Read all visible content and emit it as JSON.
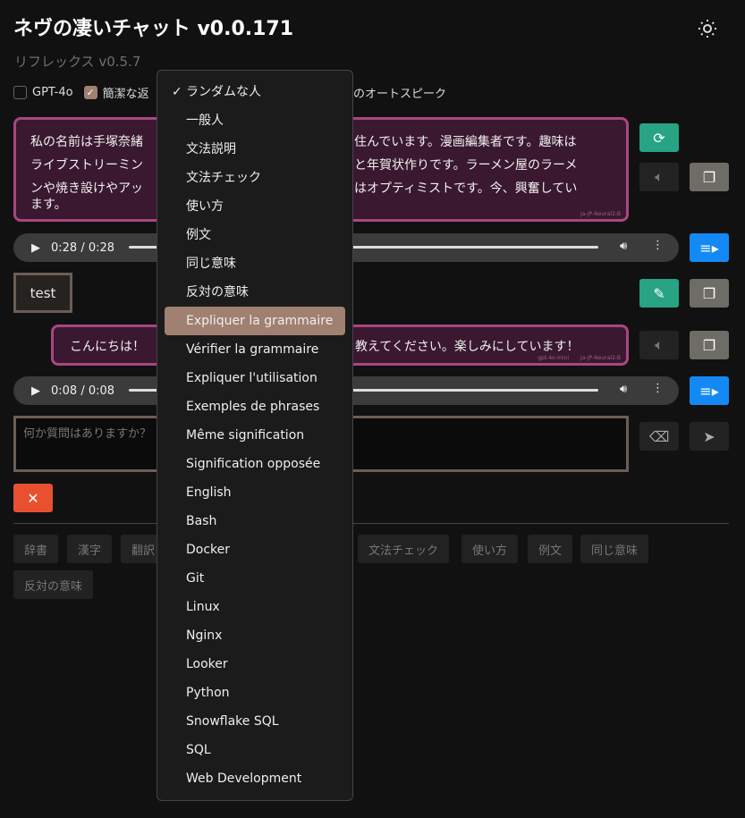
{
  "header": {
    "title": "ネヴの凄いチャット v0.0.171",
    "subtitle": "リフレックス v0.5.7",
    "theme_icon": "sun-icon"
  },
  "options": {
    "gpt4o": "GPT-4o",
    "gpt4o_checked": false,
    "concise": "簡潔な返",
    "concise_checked": true,
    "autospeak": "のオートスピーク"
  },
  "messages": [
    {
      "lines_left": [
        "私の名前は手塚奈緒",
        "ライブストリーミン",
        "ンや焼き設けやアッ",
        "ます。"
      ],
      "lines_right": [
        "住んでいます。漫画編集者です。趣味は",
        "と年賀状作りです。ラーメン屋のラーメ",
        "はオプティミストです。今、興奮してい",
        ""
      ],
      "voice": "ja-JP-Neural2-B"
    },
    {
      "user": "test"
    },
    {
      "left": "こんにちは！",
      "right": "教えてください。楽しみにしています！",
      "model": "gpt-4o-mini",
      "voice": "ja-JP-Neural2-B"
    }
  ],
  "audio": [
    {
      "time": "0:28 / 0:28"
    },
    {
      "time": "0:08 / 0:08"
    }
  ],
  "input": {
    "placeholder": "何か質問はありますか？"
  },
  "tags_left": [
    "辞書",
    "漢字",
    "翻訳"
  ],
  "tags_right": [
    "文法チェック",
    "使い方",
    "例文",
    "同じ意味"
  ],
  "tags_row2": [
    "反対の意味"
  ],
  "dropdown": {
    "selected": "ランダムな人",
    "highlighted": "Expliquer la grammaire",
    "items": [
      "ランダムな人",
      "一般人",
      "文法説明",
      "文法チェック",
      "使い方",
      "例文",
      "同じ意味",
      "反対の意味",
      "Expliquer la grammaire",
      "Vérifier la grammaire",
      "Expliquer l'utilisation",
      "Exemples de phrases",
      "Même signification",
      "Signification opposée",
      "English",
      "Bash",
      "Docker",
      "Git",
      "Linux",
      "Nginx",
      "Looker",
      "Python",
      "Snowflake SQL",
      "SQL",
      "Web Development"
    ]
  },
  "colors": {
    "accent": "#a08070",
    "message_border": "#a8467f",
    "green": "#28a383",
    "blue": "#1489f5",
    "red": "#e8502f"
  }
}
